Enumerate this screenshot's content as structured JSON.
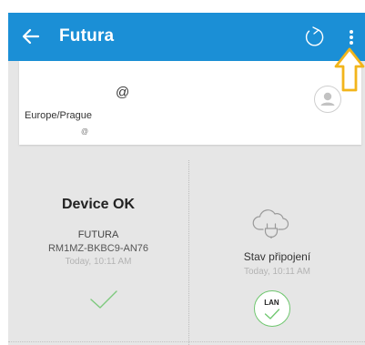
{
  "appbar": {
    "title": "Futura",
    "back_icon": "arrow-left-icon",
    "refresh_icon": "refresh-icon",
    "overflow_icon": "more-vertical-icon",
    "background_color": "#1b8fd6"
  },
  "hint": {
    "icon": "arrow-up-outline-icon",
    "color": "#f2b51b"
  },
  "account": {
    "at_symbol": "@",
    "timezone": "Europe/Prague",
    "at_symbol_small": "@",
    "avatar_icon": "person-icon"
  },
  "device_panel": {
    "status": "Device OK",
    "name": "FUTURA",
    "serial": "RM1MZ-BKBC9-AN76",
    "timestamp": "Today, 10:11 AM",
    "check_icon": "check-icon",
    "check_color": "#7dc97d"
  },
  "connection_panel": {
    "cloud_icon": "cloud-plug-icon",
    "label": "Stav připojení",
    "timestamp": "Today, 10:11 AM",
    "badge_text": "LAN",
    "badge_color": "#6fc76f"
  }
}
